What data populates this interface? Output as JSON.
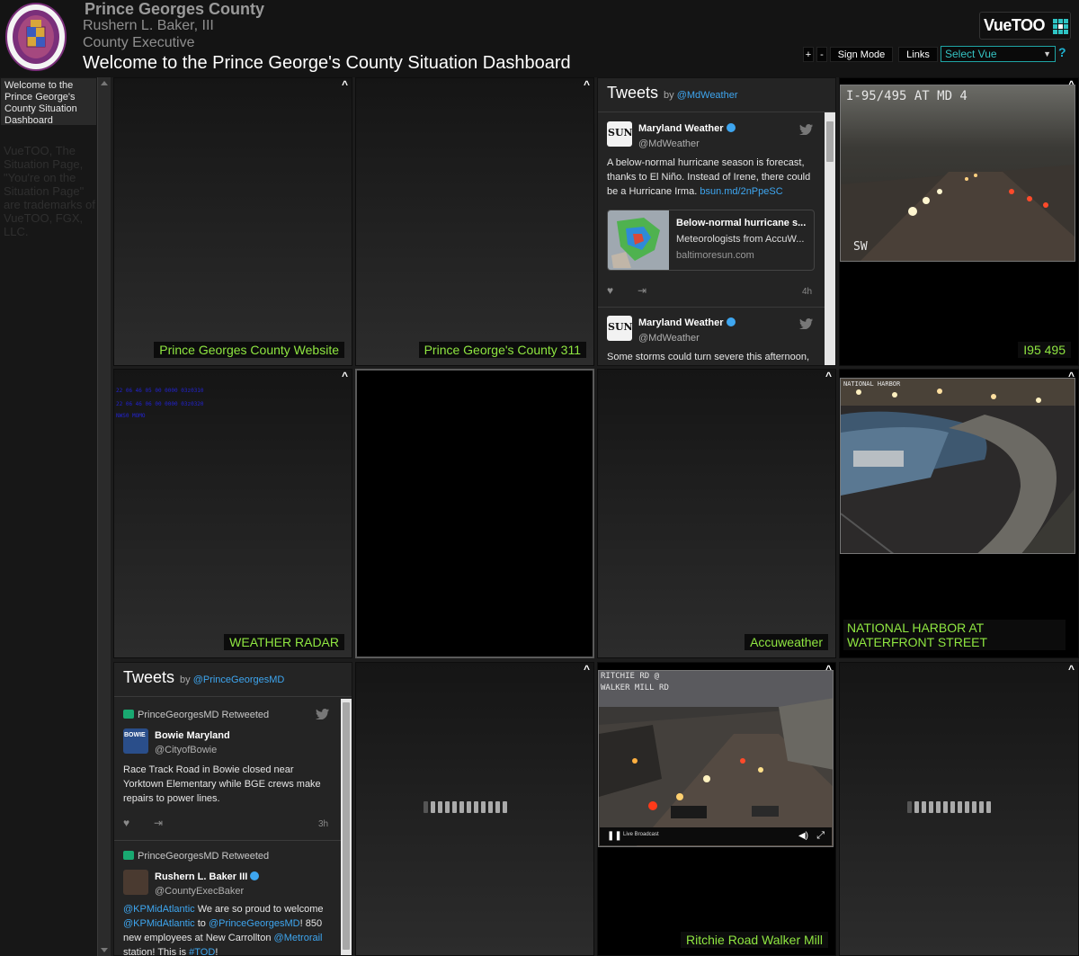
{
  "header": {
    "title": "Prince Georges County",
    "name": "Rushern L. Baker, III",
    "role": "County Executive",
    "welcome": "Welcome to the Prince George's County Situation Dashboard",
    "seal_top": "PRINCE GEORGE'S",
    "seal_bottom": "MARYLAND"
  },
  "logo": {
    "text": "VueTOO"
  },
  "toolbar": {
    "plus_label": "+",
    "minus_label": "-",
    "sign_mode_label": "Sign Mode",
    "links_label": "Links",
    "select_value": "Select Vue",
    "help_label": "?"
  },
  "sidebar": {
    "welcome": "Welcome to the Prince George's County Situation Dashboard",
    "note": "VueTOO, The Situation Page, \"You're on the Situation Page\" are trademarks of VueTOO, FGX, LLC."
  },
  "panels": {
    "caret": "^",
    "p1": "Prince Georges County Website",
    "p2": "Prince George's County 311",
    "p4": "I95 495",
    "p5": "WEATHER RADAR",
    "p7": "Accuweather",
    "p8": "NATIONAL HARBOR AT WATERFRONT STREET",
    "p11": "Ritchie Road Walker Mill"
  },
  "cams": {
    "i95_overlay": "I-95/495 AT MD 4",
    "i95_corner": "SW",
    "harbor_overlay": "NATIONAL HARBOR",
    "ritchie_line1": "RITCHIE RD @",
    "ritchie_line2": "WALKER MILL RD",
    "live": "Live Broadcast"
  },
  "radar": {
    "line1": "22 06 46 05 00 0000  03z0310",
    "line2": "22 06 46 06 00 0000  03z0320",
    "line3": "NWS0 MOMO"
  },
  "tweets_weather": {
    "heading": "Tweets",
    "by": "by",
    "handle": "@MdWeather",
    "t1": {
      "name": "Maryland Weather",
      "handle": "@MdWeather",
      "body": "A below-normal hurricane season is forecast, thanks to El Niño. Instead of Irene, there could be a Hurricane Irma.",
      "link": "bsun.md/2nPpeSC",
      "card_title": "Below-normal hurricane s...",
      "card_desc": "Meteorologists from AccuW...",
      "card_domain": "baltimoresun.com",
      "time": "4h",
      "avatar_text": "SUN"
    },
    "t2": {
      "name": "Maryland Weather",
      "handle": "@MdWeather",
      "body": "Some storms could turn severe this afternoon,",
      "avatar_text": "SUN"
    }
  },
  "tweets_county": {
    "heading": "Tweets",
    "by": "by",
    "handle": "@PrinceGeorgesMD",
    "t1": {
      "retweet": "PrinceGeorgesMD Retweeted",
      "name": "Bowie Maryland",
      "handle": "@CityofBowie",
      "body": "Race Track Road in Bowie closed near Yorktown Elementary while BGE crews make repairs to power lines.",
      "time": "3h",
      "avatar_text": "BOWIE"
    },
    "t2": {
      "retweet": "PrinceGeorgesMD Retweeted",
      "name": "Rushern L. Baker III",
      "handle": "@CountyExecBaker",
      "body_mention1": "@KPMidAtlantic",
      "body_text1": " We are so proud to welcome ",
      "body_mention2": "@KPMidAtlantic",
      "body_text2": " to ",
      "body_mention3": "@PrinceGeorgesMD",
      "body_text3": "! 850 new employees at New Carrollton ",
      "body_mention4": "@Metrorail",
      "body_text4": " station! This is ",
      "body_mention5": "#TOD",
      "body_text5": "!"
    }
  },
  "colors": {
    "label_green": "#8fe641",
    "link_blue": "#3ea6f0",
    "accent_teal": "#1fa4a4"
  }
}
